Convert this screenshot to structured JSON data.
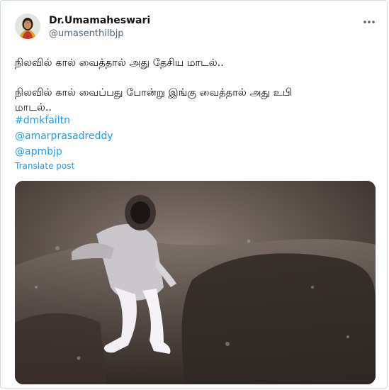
{
  "author": {
    "display_name": "Dr.Umamaheswari",
    "handle": "@umasenthilbjp"
  },
  "post": {
    "line1": "நிலவில் கால் வைத்தால் அது தேசிய மாடல்..",
    "line2": "நிலவில் கால் வைப்பது போன்று இங்கு வைத்தால் அது உபி",
    "line3": "மாடல்..",
    "hashtag": "#dmkfailtn",
    "mention1": "@amarprasadreddy",
    "mention2": "@apmbjp",
    "translate_label": "Translate post"
  },
  "icons": {
    "more": "more-horizontal-icon"
  },
  "colors": {
    "link": "#1d9bf0",
    "text": "#0f1419",
    "secondary": "#536471"
  }
}
